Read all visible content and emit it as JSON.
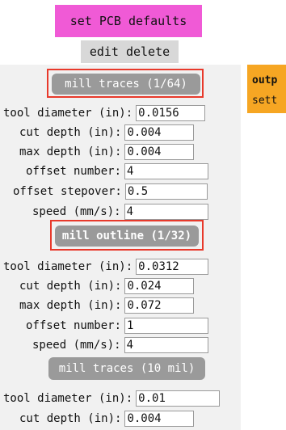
{
  "toolbar": {
    "defaults_label": "set PCB defaults",
    "edit_label": "edit",
    "delete_label": "delete"
  },
  "side_panel": {
    "line1": "outp",
    "line2": "sett"
  },
  "sections": [
    {
      "button_label": "mill traces (1/64)",
      "fields": [
        {
          "label": "tool diameter (in):",
          "value": "0.0156"
        },
        {
          "label": "cut depth (in):",
          "value": "0.004"
        },
        {
          "label": "max depth (in):",
          "value": "0.004"
        },
        {
          "label": "offset number:",
          "value": "4"
        },
        {
          "label": "offset stepover:",
          "value": "0.5"
        },
        {
          "label": "speed (mm/s):",
          "value": "4"
        }
      ]
    },
    {
      "button_label": "mill outline (1/32)",
      "fields": [
        {
          "label": "tool diameter (in):",
          "value": "0.0312"
        },
        {
          "label": "cut depth (in):",
          "value": "0.024"
        },
        {
          "label": "max depth (in):",
          "value": "0.072"
        },
        {
          "label": "offset number:",
          "value": "1"
        },
        {
          "label": "speed (mm/s):",
          "value": "4"
        }
      ]
    },
    {
      "button_label": "mill traces (10 mil)",
      "fields": [
        {
          "label": "tool diameter (in):",
          "value": "0.01"
        },
        {
          "label": "cut depth (in):",
          "value": "0.004"
        }
      ]
    }
  ],
  "colors": {
    "defaults_button": "#f05ad6",
    "panel_background": "#f1f1f1",
    "operation_button": "#9a9a9a",
    "highlight_border": "#e8392b",
    "side_panel": "#f6a623"
  }
}
